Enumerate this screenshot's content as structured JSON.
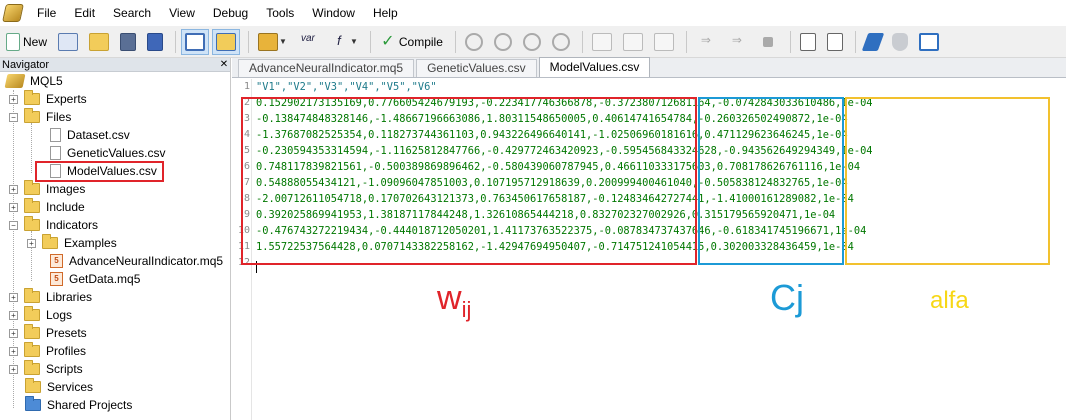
{
  "menubar": {
    "items": [
      "File",
      "Edit",
      "Search",
      "View",
      "Debug",
      "Tools",
      "Window",
      "Help"
    ]
  },
  "toolbar": {
    "new_label": "New",
    "compile_label": "Compile"
  },
  "navigator": {
    "title": "Navigator",
    "root": "MQL5",
    "items": {
      "experts": "Experts",
      "files": "Files",
      "dataset": "Dataset.csv",
      "genetic": "GeneticValues.csv",
      "model": "ModelValues.csv",
      "images": "Images",
      "include": "Include",
      "indicators": "Indicators",
      "examples": "Examples",
      "advance": "AdvanceNeuralIndicator.mq5",
      "getdata": "GetData.mq5",
      "libraries": "Libraries",
      "logs": "Logs",
      "presets": "Presets",
      "profiles": "Profiles",
      "scripts": "Scripts",
      "services": "Services",
      "shared": "Shared Projects"
    }
  },
  "tabs": [
    "AdvanceNeuralIndicator.mq5",
    "GeneticValues.csv",
    "ModelValues.csv"
  ],
  "editor": {
    "line_numbers": [
      "1",
      "2",
      "3",
      "4",
      "5",
      "6",
      "7",
      "8",
      "9",
      "10",
      "11",
      "12"
    ],
    "lines": [
      "\"V1\",\"V2\",\"V3\",\"V4\",\"V5\",\"V6\"",
      "0.152902173135169,0.776605424679193,-0.223417746366878,-0.372380712681164,-0.0742843033610486,1e-04",
      "-0.138474848328146,-1.48667196663086,1.80311548650005,0.40614741654784,-0.260326502490872,1e-04",
      "-1.37687082525354,0.118273744361103,0.943226496640141,-1.02506960181616,0.471129623646245,1e-04",
      "-0.230594353314594,-1.11625812847766,-0.429772463420923,-0.595456843324628,-0.943562649294349,1e-04",
      "0.748117839821561,-0.500389869896462,-0.580439060787945,0.466110333175603,0.708178626761116,1e-04",
      "0.54888055434121,-1.09096047851003,0.107195712918639,0.200999400461040,-0.505838124832765,1e-04",
      "-2.00712611054718,0.170702643121373,0.763450617658187,-0.124834642727441,-1.41000161289082,1e-04",
      "0.392025869941953,1.38187117844248,1.32610865444218,0.832702327002926,0.315179565920471,1e-04",
      "-0.476743272219434,-0.444018712050201,1.41173763522375,-0.087834737437646,-0.618341745196671,1e-04",
      "1.55722537564428,0.0707143382258162,-1.42947694950407,-0.714751241054415,0.302003328436459,1e-04",
      ""
    ]
  },
  "annotations": {
    "w": "w",
    "w_sub": "ij",
    "c": "Cj",
    "alfa": "alfa"
  }
}
